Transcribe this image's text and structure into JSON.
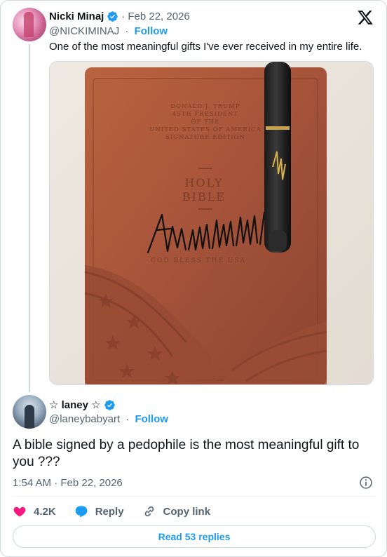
{
  "colors": {
    "accent": "#1d9bf0",
    "like": "#f91880",
    "reply": "#1d9bf0",
    "muted": "#536471",
    "text": "#0f1419",
    "border": "#cfd9de"
  },
  "brand_icon": "x-logo-icon",
  "tweet": {
    "display_name": "Nicki Minaj",
    "verified_icon": "verified-badge-icon",
    "date": "Feb 22, 2026",
    "handle": "@NICKIMINAJ",
    "follow_label": "Follow",
    "text": "One of the most meaningful gifts I've ever received in my entire life.",
    "photo": {
      "cover_lines": [
        "DONALD J. TRUMP",
        "45TH PRESIDENT",
        "OF THE",
        "UNITED STATES OF AMERICA",
        "SIGNATURE EDITION"
      ],
      "title_line_1": "HOLY",
      "title_line_2": "BIBLE",
      "footer": "GOD BLESS THE USA"
    }
  },
  "reply": {
    "display_name": "☆ laney ☆",
    "verified_icon": "verified-badge-icon",
    "handle": "@laneybabyart",
    "follow_label": "Follow",
    "text": "A bible signed by a pedophile is the most meaningful gift to you ???",
    "timestamp": "1:54 AM · Feb 22, 2026",
    "info_icon": "info-icon"
  },
  "actions": {
    "like_count": "4.2K",
    "reply_label": "Reply",
    "copy_link_label": "Copy link"
  },
  "read_replies_label": "Read 53 replies"
}
